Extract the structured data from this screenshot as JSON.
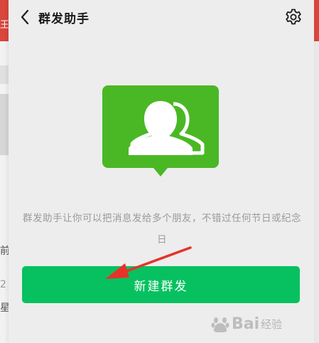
{
  "background_app": {
    "fragment_1": "王",
    "fragment_2": "前.",
    "fragment_3": "2",
    "fragment_4": "星"
  },
  "nav": {
    "title": "群发助手",
    "back_icon": "chevron-left-icon",
    "settings_icon": "gear-icon"
  },
  "main": {
    "hero_icon": "group-chat-icon",
    "description": "群发助手让你可以把消息发给多个朋友，不错过任何节日或纪念日",
    "new_button_label": "新建群发"
  },
  "watermark": {
    "brand": "Bai",
    "sub": "经验"
  },
  "colors": {
    "accent": "#07c160",
    "hero_green": "#4ab825",
    "annotation_red": "#e63329"
  }
}
